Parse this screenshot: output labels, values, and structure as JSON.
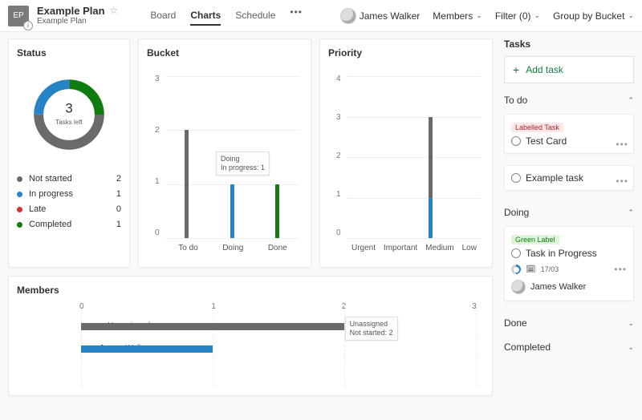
{
  "header": {
    "plan_icon_text": "EP",
    "plan_title": "Example Plan",
    "plan_subtitle": "Example Plan",
    "nav": {
      "board": "Board",
      "charts": "Charts",
      "schedule": "Schedule"
    },
    "user_name": "James Walker",
    "controls": {
      "members": "Members",
      "filter": "Filter (0)",
      "group": "Group by Bucket"
    }
  },
  "status_card": {
    "title": "Status",
    "center_value": "3",
    "center_label": "Tasks left",
    "legend": [
      {
        "label": "Not started",
        "value": "2",
        "color": "#6a6a6a"
      },
      {
        "label": "In progress",
        "value": "1",
        "color": "#2683c6"
      },
      {
        "label": "Late",
        "value": "0",
        "color": "#d13438"
      },
      {
        "label": "Completed",
        "value": "1",
        "color": "#107c10"
      }
    ]
  },
  "chart_data": [
    {
      "id": "status_donut",
      "type": "pie",
      "title": "Status",
      "series": [
        {
          "name": "Not started",
          "values": [
            2
          ],
          "color": "#6a6a6a"
        },
        {
          "name": "In progress",
          "values": [
            1
          ],
          "color": "#2683c6"
        },
        {
          "name": "Late",
          "values": [
            0
          ],
          "color": "#d13438"
        },
        {
          "name": "Completed",
          "values": [
            1
          ],
          "color": "#107c10"
        }
      ],
      "center_text": "3 Tasks left"
    },
    {
      "id": "bucket",
      "type": "bar",
      "title": "Bucket",
      "categories": [
        "To do",
        "Doing",
        "Done"
      ],
      "series": [
        {
          "name": "Not started",
          "values": [
            2,
            0,
            0
          ],
          "color": "#6a6a6a"
        },
        {
          "name": "In progress",
          "values": [
            0,
            1,
            0
          ],
          "color": "#2683c6"
        },
        {
          "name": "Completed",
          "values": [
            0,
            0,
            1
          ],
          "color": "#107c10"
        }
      ],
      "ylim": [
        0,
        3
      ],
      "yticks": [
        0,
        1,
        2,
        3
      ],
      "tooltip": {
        "category": "Doing",
        "text_line1": "Doing",
        "text_line2": "In progress: 1"
      }
    },
    {
      "id": "priority",
      "type": "bar",
      "title": "Priority",
      "categories": [
        "Urgent",
        "Important",
        "Medium",
        "Low"
      ],
      "series": [
        {
          "name": "Not started",
          "values": [
            0,
            0,
            2,
            0
          ],
          "color": "#6a6a6a"
        },
        {
          "name": "In progress",
          "values": [
            0,
            0,
            1,
            0
          ],
          "color": "#2683c6"
        }
      ],
      "ylim": [
        0,
        4
      ],
      "yticks": [
        0,
        1,
        2,
        3,
        4
      ]
    },
    {
      "id": "members",
      "type": "bar",
      "orientation": "horizontal",
      "title": "Members",
      "categories": [
        "Unassigned",
        "James Walker"
      ],
      "series": [
        {
          "name": "Not started",
          "values": [
            2,
            0
          ],
          "color": "#6a6a6a"
        },
        {
          "name": "In progress",
          "values": [
            0,
            1
          ],
          "color": "#2683c6"
        }
      ],
      "xlim": [
        0,
        3
      ],
      "xticks": [
        0,
        1,
        2,
        3
      ],
      "tooltip": {
        "category": "Unassigned",
        "text_line1": "Unassigned",
        "text_line2": "Not started: 2"
      }
    }
  ],
  "bucket_card": {
    "title": "Bucket",
    "yticks": [
      "3",
      "2",
      "1",
      "0"
    ],
    "xlabels": [
      "To do",
      "Doing",
      "Done"
    ],
    "tooltip": {
      "line1": "Doing",
      "line2": "In progress: 1"
    }
  },
  "priority_card": {
    "title": "Priority",
    "yticks": [
      "4",
      "3",
      "2",
      "1",
      "0"
    ],
    "xlabels": [
      "Urgent",
      "Important",
      "Medium",
      "Low"
    ]
  },
  "members_card": {
    "title": "Members",
    "xticks": [
      "0",
      "1",
      "2",
      "3"
    ],
    "rows": [
      "Unassigned",
      "James Walker"
    ],
    "tooltip": {
      "line1": "Unassigned",
      "line2": "Not started: 2"
    }
  },
  "right_panel": {
    "title": "Tasks",
    "add_task": "Add task",
    "sections": {
      "todo": "To do",
      "doing": "Doing",
      "done": "Done",
      "completed": "Completed"
    },
    "todo_tasks": {
      "t1_label": "Labelled Task",
      "t1_title": "Test Card",
      "t2_title": "Example task"
    },
    "doing_task": {
      "label": "Green Label",
      "title": "Task in Progress",
      "date": "17/03",
      "assignee": "James Walker"
    }
  }
}
